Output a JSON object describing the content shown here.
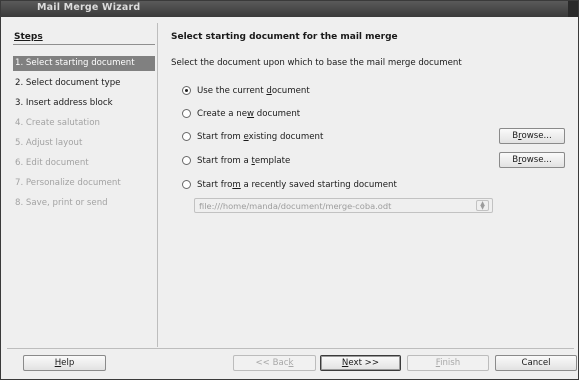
{
  "window": {
    "title": "Mail Merge Wizard"
  },
  "steps": {
    "heading": "Steps",
    "items": [
      {
        "label": "1. Select starting document",
        "state": "active"
      },
      {
        "label": "2. Select document type",
        "state": "enabled"
      },
      {
        "label": "3. Insert address block",
        "state": "enabled"
      },
      {
        "label": "4. Create salutation",
        "state": "disabled"
      },
      {
        "label": "5. Adjust layout",
        "state": "disabled"
      },
      {
        "label": "6. Edit document",
        "state": "disabled"
      },
      {
        "label": "7. Personalize document",
        "state": "disabled"
      },
      {
        "label": "8. Save, print or send",
        "state": "disabled"
      }
    ]
  },
  "content": {
    "heading": "Select starting document for the mail merge",
    "description": "Select the document upon which to base the mail merge document",
    "options": {
      "current": {
        "pre": "Use the current ",
        "mn": "d",
        "post": "ocument",
        "checked": true
      },
      "new": {
        "pre": "Create a ne",
        "mn": "w",
        "post": " document",
        "checked": false
      },
      "existing": {
        "pre": "Start from ",
        "mn": "e",
        "post": "xisting document",
        "checked": false
      },
      "template": {
        "pre": "Start from a ",
        "mn": "t",
        "post": "emplate",
        "checked": false
      },
      "recent": {
        "pre": "Start fro",
        "mn": "m",
        "post": " a recently saved starting document",
        "checked": false
      }
    },
    "browse_existing": {
      "pre": "B",
      "mn": "r",
      "post": "owse..."
    },
    "browse_template": {
      "pre": "B",
      "mn": "r",
      "post": "owse..."
    },
    "recent_file": "file:///home/manda/document/merge-coba.odt"
  },
  "footer": {
    "help": {
      "pre": "",
      "mn": "H",
      "post": "elp"
    },
    "back": {
      "pre": "<< Bac",
      "mn": "k",
      "post": ""
    },
    "next": {
      "pre": "",
      "mn": "N",
      "post": "ext >>"
    },
    "finish": {
      "pre": "",
      "mn": "F",
      "post": "inish"
    },
    "cancel": {
      "label": "Cancel"
    }
  },
  "icons": {
    "spin": "up-down-spin-icon"
  }
}
